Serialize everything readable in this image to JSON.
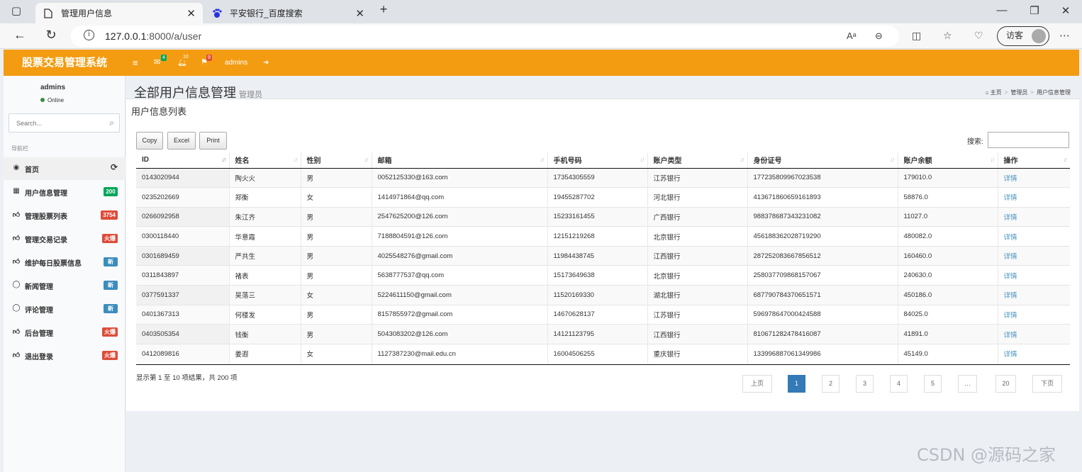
{
  "browser": {
    "tabs": [
      {
        "title": "管理用户信息",
        "active": true
      },
      {
        "title": "平安银行_百度搜索",
        "active": false
      }
    ],
    "url_host": "127.0.0.1",
    "url_path": ":8000/a/user",
    "guest_label": "访客"
  },
  "app": {
    "brand": "股票交易管理系统",
    "header": {
      "mail_count": "4",
      "bell_count": "10",
      "flag_count": "9",
      "username": "admins"
    }
  },
  "sidebar": {
    "user_name": "admins",
    "status": "Online",
    "search_placeholder": "Search...",
    "nav_header": "导航栏",
    "items": [
      {
        "label": "首页",
        "icon": "dashboard-icon",
        "badge": ""
      },
      {
        "label": "用户信息管理",
        "icon": "grid-icon",
        "badge": "200",
        "badge_color": "#00a65a"
      },
      {
        "label": "管理股票列表",
        "icon": "thumbs-up-icon",
        "badge": "3754",
        "badge_color": "#dd4b39"
      },
      {
        "label": "管理交易记录",
        "icon": "thumbs-up-icon",
        "badge": "火爆",
        "badge_color": "#dd4b39"
      },
      {
        "label": "维护每日股票信息",
        "icon": "thumbs-up-icon",
        "badge": "新",
        "badge_color": "#3c8dbc"
      },
      {
        "label": "新闻管理",
        "icon": "comment-icon",
        "badge": "新",
        "badge_color": "#3c8dbc"
      },
      {
        "label": "评论管理",
        "icon": "comment-icon",
        "badge": "新",
        "badge_color": "#3c8dbc"
      },
      {
        "label": "后台管理",
        "icon": "thumbs-up-icon",
        "badge": "火爆",
        "badge_color": "#dd4b39"
      },
      {
        "label": "退出登录",
        "icon": "thumbs-up-icon",
        "badge": "火爆",
        "badge_color": "#dd4b39"
      }
    ]
  },
  "page": {
    "title": "全部用户信息管理",
    "subtitle": "管理员",
    "breadcrumb": [
      "主页",
      "管理员",
      "用户信息管理"
    ],
    "box_title": "用户信息列表",
    "buttons": [
      "Copy",
      "Excel",
      "Print"
    ],
    "search_label": "搜索:"
  },
  "table": {
    "columns": [
      "ID",
      "姓名",
      "性别",
      "邮箱",
      "手机号码",
      "账户类型",
      "身份证号",
      "账户余额",
      "操作"
    ],
    "rows": [
      [
        "0143020944",
        "陶火火",
        "男",
        "0052125330@163.com",
        "17354305559",
        "江苏银行",
        "177235809967023538",
        "179010.0",
        "详情"
      ],
      [
        "0235202669",
        "郑衡",
        "女",
        "1414971864@qq.com",
        "19455287702",
        "河北银行",
        "413671860659161893",
        "58876.0",
        "详情"
      ],
      [
        "0266092958",
        "朱江齐",
        "男",
        "2547625200@126.com",
        "15233161455",
        "广西银行",
        "988378687343231082",
        "11027.0",
        "详情"
      ],
      [
        "0300118440",
        "华意霞",
        "男",
        "7188804591@126.com",
        "12151219268",
        "北京银行",
        "456188362028719290",
        "480082.0",
        "详情"
      ],
      [
        "0301689459",
        "严共生",
        "男",
        "4025548276@gmail.com",
        "11984438745",
        "江西银行",
        "287252083667856512",
        "160460.0",
        "详情"
      ],
      [
        "0311843897",
        "褚表",
        "男",
        "5638777537@qq.com",
        "15173649638",
        "北京银行",
        "258037709868157067",
        "240630.0",
        "详情"
      ],
      [
        "0377591337",
        "吴落三",
        "女",
        "5224611150@gmail.com",
        "11520169330",
        "湖北银行",
        "687790784370651571",
        "450186.0",
        "详情"
      ],
      [
        "0401367313",
        "何楼发",
        "男",
        "8157855972@gmail.com",
        "14670628137",
        "江苏银行",
        "596978647000424588",
        "84025.0",
        "详情"
      ],
      [
        "0403505354",
        "钱衡",
        "男",
        "5043083202@126.com",
        "14121123795",
        "江西银行",
        "810671282478416087",
        "41891.0",
        "详情"
      ],
      [
        "0412089816",
        "姜遐",
        "女",
        "1127387230@mail.edu.cn",
        "16004506255",
        "重庆银行",
        "133996887061349986",
        "45149.0",
        "详情"
      ]
    ]
  },
  "pagination": {
    "info": "显示第 1 至 10 项结果，共 200 项",
    "prev": "上页",
    "pages": [
      "1",
      "2",
      "3",
      "4",
      "5",
      "…",
      "20"
    ],
    "current": "1",
    "next": "下页"
  },
  "watermark": "CSDN @源码之家"
}
